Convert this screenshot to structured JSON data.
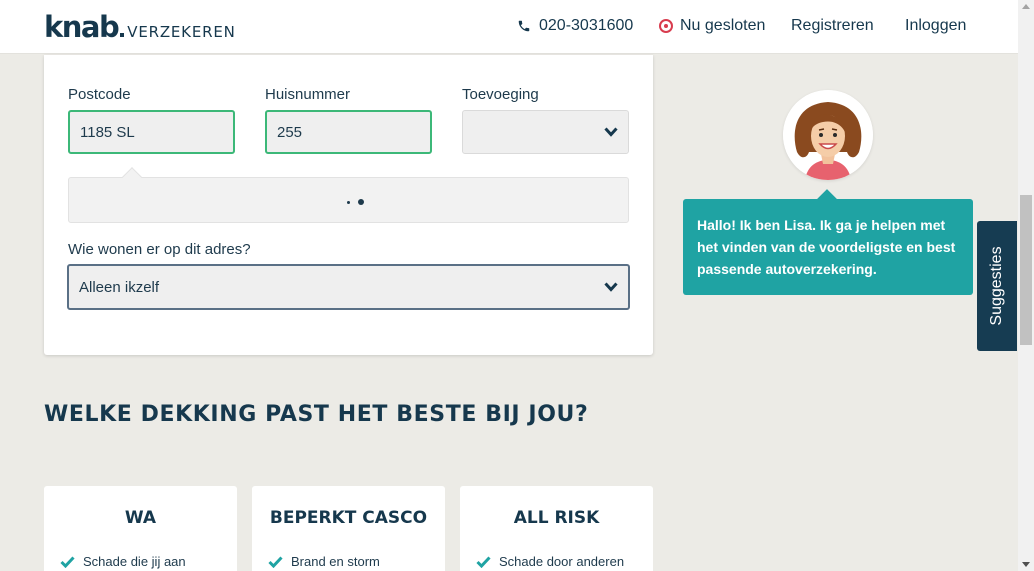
{
  "header": {
    "logo_main": "knab",
    "logo_sub": "VERZEKEREN",
    "phone": "020-3031600",
    "status": "Nu gesloten",
    "register": "Registreren",
    "login": "Inloggen"
  },
  "form": {
    "postcode_label": "Postcode",
    "postcode_value": "1185 SL",
    "housenumber_label": "Huisnummer",
    "housenumber_value": "255",
    "addition_label": "Toevoeging",
    "addition_value": "",
    "residents_label": "Wie wonen er op dit adres?",
    "residents_value": "Alleen ikzelf"
  },
  "section_title": "WELKE DEKKING PAST HET BESTE BIJ JOU?",
  "coverage": [
    {
      "title": "WA",
      "item": "Schade die jij aan"
    },
    {
      "title": "BEPERKT CASCO",
      "item": "Brand en storm"
    },
    {
      "title": "ALL RISK",
      "item": "Schade door anderen"
    }
  ],
  "assistant": {
    "message": "Hallo! Ik ben Lisa. Ik ga je helpen met het vinden van de voordeligste en best passende autoverzekering."
  },
  "suggestions_label": "Suggesties",
  "colors": {
    "brand_navy": "#16384d",
    "valid_green": "#3cb878",
    "assistant_teal": "#1fa3a3",
    "closed_red": "#d83c4e"
  },
  "icons": [
    "phone-icon",
    "closed-status-icon",
    "chevron-down-icon",
    "check-icon",
    "avatar-lisa"
  ]
}
